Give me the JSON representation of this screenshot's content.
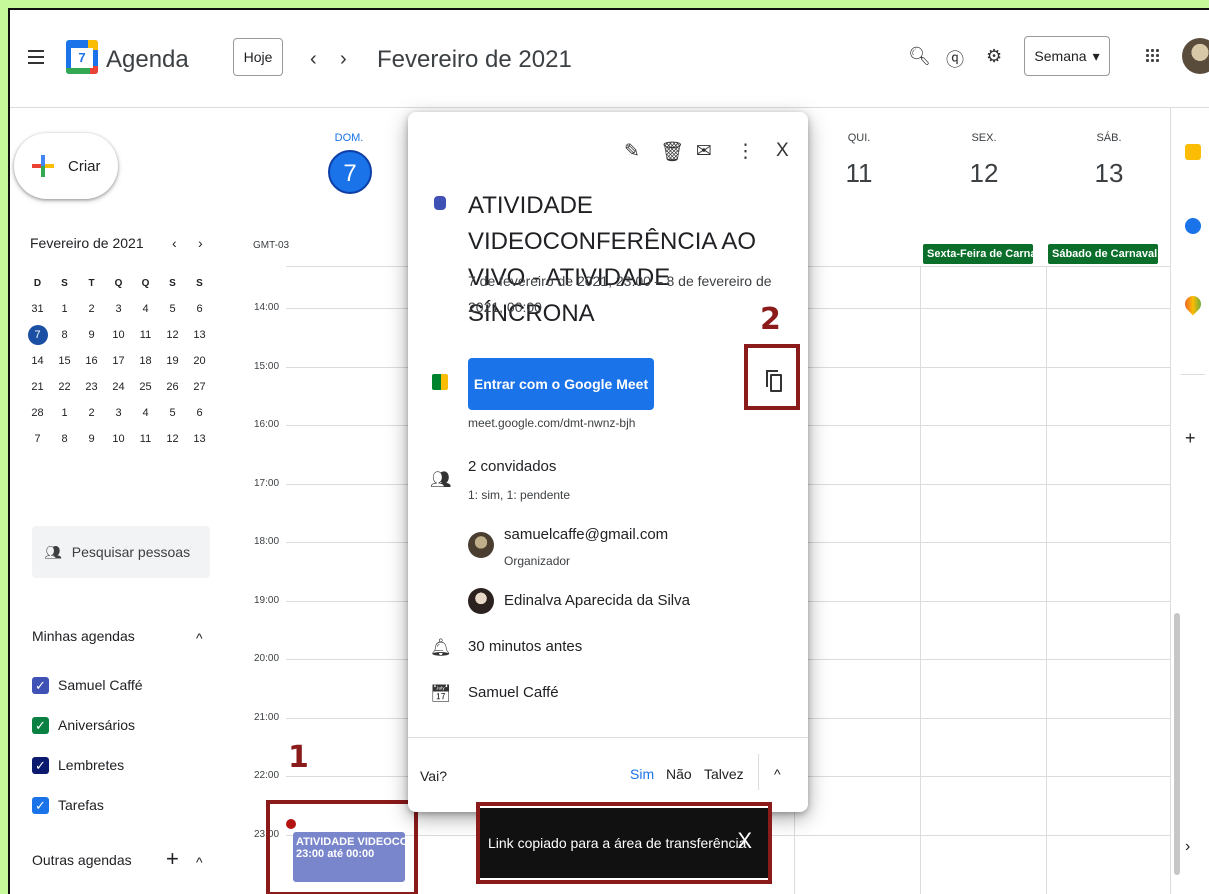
{
  "header": {
    "app_title": "Agenda",
    "logo_day": "7",
    "today_label": "Hoje",
    "prev": "‹",
    "next": "›",
    "month_title": "Fevereiro de 2021",
    "view_label": "Semana",
    "view_caret": "▾"
  },
  "sidebar": {
    "create_label": "Criar",
    "mini_title": "Fevereiro de 2021",
    "mini_prev": "‹",
    "mini_next": "›",
    "weekdays": [
      "D",
      "S",
      "T",
      "Q",
      "Q",
      "S",
      "S"
    ],
    "weeks": [
      [
        "31",
        "1",
        "2",
        "3",
        "4",
        "5",
        "6"
      ],
      [
        "7",
        "8",
        "9",
        "10",
        "11",
        "12",
        "13"
      ],
      [
        "14",
        "15",
        "16",
        "17",
        "18",
        "19",
        "20"
      ],
      [
        "21",
        "22",
        "23",
        "24",
        "25",
        "26",
        "27"
      ],
      [
        "28",
        "1",
        "2",
        "3",
        "4",
        "5",
        "6"
      ],
      [
        "7",
        "8",
        "9",
        "10",
        "11",
        "12",
        "13"
      ]
    ],
    "search_people": "Pesquisar pessoas",
    "my_calendars_title": "Minhas agendas",
    "calendars": [
      {
        "label": "Samuel Caffé",
        "color": "#3f51b5"
      },
      {
        "label": "Aniversários",
        "color": "#0b8043"
      },
      {
        "label": "Lembretes",
        "color": "#0b1a6e"
      },
      {
        "label": "Tarefas",
        "color": "#1a73e8"
      }
    ],
    "other_calendars_title": "Outras agendas",
    "add": "+",
    "chevron_up": "^"
  },
  "week": {
    "gmt": "GMT-03",
    "days": [
      {
        "name": "DOM.",
        "num": "7"
      },
      {
        "name": "QUI.",
        "num": "11"
      },
      {
        "name": "SEX.",
        "num": "12"
      },
      {
        "name": "SÁB.",
        "num": "13"
      }
    ],
    "times": [
      "14:00",
      "15:00",
      "16:00",
      "17:00",
      "18:00",
      "19:00",
      "20:00",
      "21:00",
      "22:00",
      "23:00"
    ],
    "allday": [
      "Sexta-Feira de Carnav",
      "Sábado de Carnaval"
    ],
    "event": {
      "title": "ATIVIDADE VIDEOCON",
      "time": "23:00 até 00:00"
    }
  },
  "popup": {
    "title": "ATIVIDADE VIDEOCONFERÊNCIA AO VIVO - ATIVIDADE SÍNCRONA",
    "datetime": "7 de fevereiro de 2021, 23:00 – 8 de fevereiro de 2021, 00:00",
    "meet_button": "Entrar com o Google Meet",
    "meet_link": "meet.google.com/dmt-nwnz-bjh",
    "guests_count": "2 convidados",
    "guests_status": "1: sim, 1: pendente",
    "guest1": "samuelcaffe@gmail.com",
    "guest1_role": "Organizador",
    "guest2": "Edinalva Aparecida da Silva",
    "reminder": "30 minutos antes",
    "calendar": "Samuel Caffé",
    "rsvp_question": "Vai?",
    "rsvp_yes": "Sim",
    "rsvp_no": "Não",
    "rsvp_maybe": "Talvez",
    "close": "X"
  },
  "toast": {
    "message": "Link copiado para a área de transferência",
    "close": "X"
  },
  "annotations": {
    "one": "1",
    "two": "2"
  },
  "colors": {
    "accent": "#1a73e8",
    "highlight_box": "#8b1a1a",
    "event": "#7986cb",
    "holiday": "#0b6e2a"
  }
}
